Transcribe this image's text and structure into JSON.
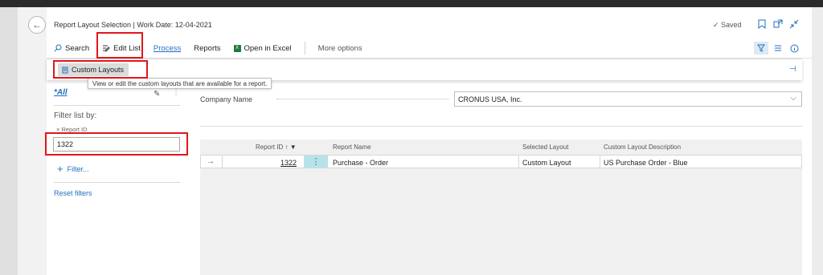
{
  "header": {
    "title": "Report Layout Selection | Work Date: 12-04-2021",
    "saved_label": "Saved"
  },
  "actions": [
    {
      "label": "Search",
      "icon": "search-icon"
    },
    {
      "label": "Edit List",
      "icon": "edit-list-icon"
    },
    {
      "label": "Process",
      "icon": null
    },
    {
      "label": "Reports",
      "icon": null
    },
    {
      "label": "Open in Excel",
      "icon": "excel-icon"
    },
    {
      "label": "More options",
      "icon": null
    }
  ],
  "submenu": {
    "custom_layouts_label": "Custom Layouts",
    "tooltip": "View or edit the custom layouts that are available for a report."
  },
  "filters": {
    "view_all": "*All",
    "filter_list_by": "Filter list by:",
    "field_label": "× Report ID",
    "field_value": "1322",
    "add_filter": "Filter...",
    "reset": "Reset filters"
  },
  "company": {
    "label": "Company Name",
    "value": "CRONUS USA, Inc."
  },
  "table": {
    "columns": [
      "Report ID ↑",
      "Report Name",
      "Selected Layout",
      "Custom Layout Description"
    ],
    "rows": [
      {
        "report_id": "1322",
        "report_name": "Purchase - Order",
        "selected_layout": "Custom Layout",
        "custom_layout_description": "US Purchase Order - Blue"
      }
    ]
  },
  "colors": {
    "accent": "#1f6fbf",
    "highlight": "#e0161b",
    "selected_cell": "#b7e3e8"
  }
}
